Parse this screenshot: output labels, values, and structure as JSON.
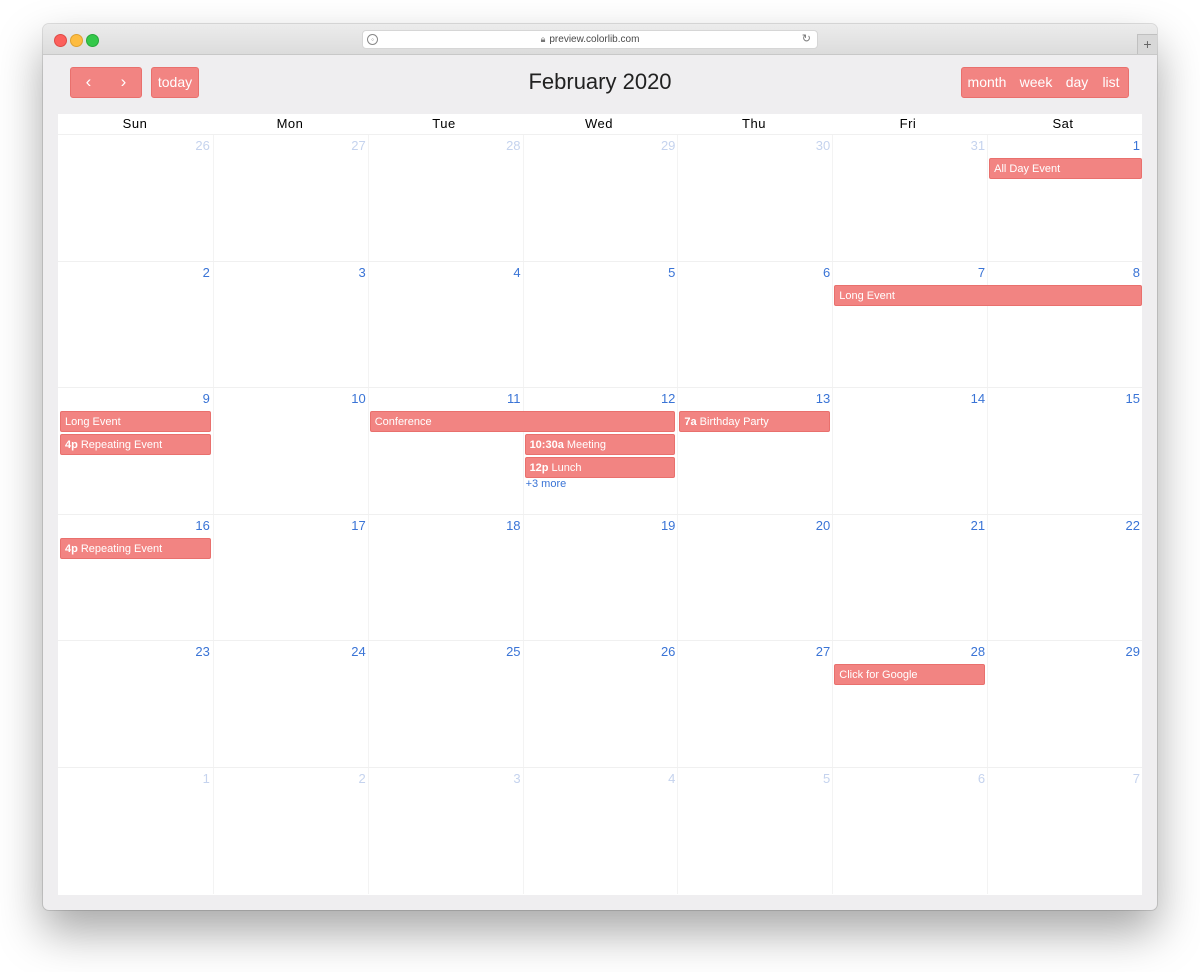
{
  "browser": {
    "url": "preview.colorlib.com",
    "new_tab": "+",
    "lock_icon": "lock-icon",
    "reload_icon": "reload-icon"
  },
  "toolbar": {
    "prev_symbol": "‹",
    "next_symbol": "›",
    "today_label": "today",
    "title": "February 2020",
    "views": [
      "month",
      "week",
      "day",
      "list"
    ]
  },
  "calendar": {
    "days_of_week": [
      "Sun",
      "Mon",
      "Tue",
      "Wed",
      "Thu",
      "Fri",
      "Sat"
    ],
    "weeks": [
      {
        "days": [
          {
            "n": "26",
            "other": true
          },
          {
            "n": "27",
            "other": true
          },
          {
            "n": "28",
            "other": true
          },
          {
            "n": "29",
            "other": true
          },
          {
            "n": "30",
            "other": true
          },
          {
            "n": "31",
            "other": true
          },
          {
            "n": "1",
            "other": false
          }
        ]
      },
      {
        "days": [
          {
            "n": "2",
            "other": false
          },
          {
            "n": "3",
            "other": false
          },
          {
            "n": "4",
            "other": false
          },
          {
            "n": "5",
            "other": false
          },
          {
            "n": "6",
            "other": false
          },
          {
            "n": "7",
            "other": false
          },
          {
            "n": "8",
            "other": false
          }
        ]
      },
      {
        "days": [
          {
            "n": "9",
            "other": false
          },
          {
            "n": "10",
            "other": false
          },
          {
            "n": "11",
            "other": false
          },
          {
            "n": "12",
            "other": false
          },
          {
            "n": "13",
            "other": false
          },
          {
            "n": "14",
            "other": false
          },
          {
            "n": "15",
            "other": false
          }
        ]
      },
      {
        "days": [
          {
            "n": "16",
            "other": false
          },
          {
            "n": "17",
            "other": false
          },
          {
            "n": "18",
            "other": false
          },
          {
            "n": "19",
            "other": false
          },
          {
            "n": "20",
            "other": false
          },
          {
            "n": "21",
            "other": false
          },
          {
            "n": "22",
            "other": false
          }
        ]
      },
      {
        "days": [
          {
            "n": "23",
            "other": false
          },
          {
            "n": "24",
            "other": false
          },
          {
            "n": "25",
            "other": false
          },
          {
            "n": "26",
            "other": false
          },
          {
            "n": "27",
            "other": false
          },
          {
            "n": "28",
            "other": false
          },
          {
            "n": "29",
            "other": false
          }
        ]
      },
      {
        "days": [
          {
            "n": "1",
            "other": true
          },
          {
            "n": "2",
            "other": true
          },
          {
            "n": "3",
            "other": true
          },
          {
            "n": "4",
            "other": true
          },
          {
            "n": "5",
            "other": true
          },
          {
            "n": "6",
            "other": true
          },
          {
            "n": "7",
            "other": true
          }
        ]
      }
    ],
    "events": [
      {
        "week": 0,
        "start": 6,
        "span": 1,
        "slot": 0,
        "time": "",
        "title": "All Day Event"
      },
      {
        "week": 1,
        "start": 5,
        "span": 2,
        "slot": 0,
        "time": "",
        "title": "Long Event"
      },
      {
        "week": 2,
        "start": 0,
        "span": 1,
        "slot": 0,
        "time": "",
        "title": "Long Event"
      },
      {
        "week": 2,
        "start": 0,
        "span": 1,
        "slot": 1,
        "time": "4p",
        "title": "Repeating Event"
      },
      {
        "week": 2,
        "start": 2,
        "span": 2,
        "slot": 0,
        "time": "",
        "title": "Conference"
      },
      {
        "week": 2,
        "start": 3,
        "span": 1,
        "slot": 1,
        "time": "10:30a",
        "title": "Meeting"
      },
      {
        "week": 2,
        "start": 3,
        "span": 1,
        "slot": 2,
        "time": "12p",
        "title": "Lunch"
      },
      {
        "week": 2,
        "start": 4,
        "span": 1,
        "slot": 0,
        "time": "7a",
        "title": "Birthday Party"
      },
      {
        "week": 3,
        "start": 0,
        "span": 1,
        "slot": 0,
        "time": "4p",
        "title": "Repeating Event"
      },
      {
        "week": 4,
        "start": 5,
        "span": 1,
        "slot": 0,
        "time": "",
        "title": "Click for Google"
      }
    ],
    "more_links": [
      {
        "week": 2,
        "day": 3,
        "slot": 3,
        "label": "+3 more"
      }
    ]
  },
  "colors": {
    "accent": "#f28482",
    "day_number": "#3a74d6",
    "day_number_other": "#c5d3ee"
  }
}
